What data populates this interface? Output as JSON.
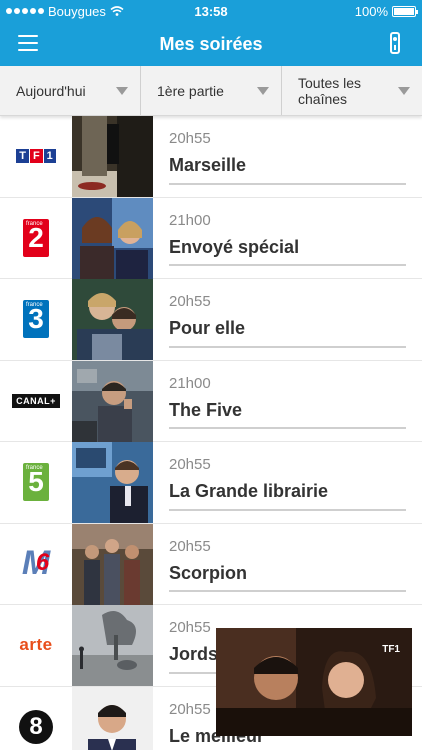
{
  "status_bar": {
    "carrier": "Bouygues",
    "time": "13:58",
    "battery": "100%",
    "battery_level": 1.0
  },
  "nav": {
    "title": "Mes soirées",
    "menu_icon": "hamburger-icon",
    "remote_icon": "remote-control-icon"
  },
  "filters": [
    {
      "label": "Aujourd'hui"
    },
    {
      "label": "1ère partie"
    },
    {
      "label": "Toutes les chaînes"
    }
  ],
  "programs": [
    {
      "channel": "TF1",
      "time": "20h55",
      "title": "Marseille"
    },
    {
      "channel": "France 2",
      "logo_text": "2",
      "logo_small": "france",
      "time": "21h00",
      "title": "Envoyé spécial"
    },
    {
      "channel": "France 3",
      "logo_text": "3",
      "logo_small": "france",
      "time": "20h55",
      "title": "Pour elle"
    },
    {
      "channel": "CANAL+",
      "logo_text": "CANAL+",
      "time": "21h00",
      "title": "The Five"
    },
    {
      "channel": "France 5",
      "logo_text": "5",
      "logo_small": "france",
      "time": "20h55",
      "title": "La Grande librairie"
    },
    {
      "channel": "M6",
      "logo_text": "M",
      "logo_digit": "6",
      "time": "20h55",
      "title": "Scorpion"
    },
    {
      "channel": "arte",
      "logo_text": "arte",
      "time": "20h55",
      "title": "Jordsk"
    },
    {
      "channel": "D8",
      "logo_text": "8",
      "time": "20h55",
      "title": "Le meilleur"
    }
  ],
  "tf1_logo": [
    "T",
    "F",
    "1"
  ],
  "pip": {
    "badge": "TF1"
  },
  "colors": {
    "brand": "#1a9fd9",
    "tf1_red": "#e2001a",
    "tf1_blue": "#1c3f94",
    "france2": "#e2001a",
    "france3": "#0072bc",
    "france5": "#6bb13d",
    "arte": "#e84e1b"
  }
}
